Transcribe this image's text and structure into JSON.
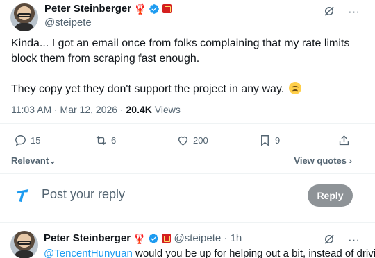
{
  "tweet": {
    "author_name": "Peter Steinberger",
    "author_emoji": "🦞",
    "handle": "@steipete",
    "body_line1": "Kinda... I got an email once from folks complaining that my rate limits block them from scraping fast enough.",
    "body_line2": "They copy yet they don't support the project in any way.",
    "time": "11:03 AM · Mar 12, 2026 · ",
    "views_count": "20.4K",
    "views_label": " Views",
    "more_label": "···"
  },
  "metrics": {
    "replies": "15",
    "reposts": "6",
    "likes": "200",
    "bookmarks": "9"
  },
  "controls": {
    "sort_label": "Relevant",
    "sort_chevron": "⌄",
    "view_quotes_label": "View quotes",
    "view_quotes_chevron": "›"
  },
  "composer": {
    "placeholder": "Post your reply",
    "reply_button": "Reply"
  },
  "reply": {
    "author_name": "Peter Steinberger",
    "author_emoji": "🦞",
    "handle_time": "@steipete · 1h",
    "mention": "@TencentHunyuan",
    "text": " would you be up for helping out a bit, instead of driving",
    "more_label": "···"
  },
  "colors": {
    "accent": "#1d9bf0",
    "text": "#0f1419",
    "muted": "#536471",
    "reply_button_bg": "#8e9397"
  },
  "icons": {
    "verified": "verified-badge-icon",
    "flag": "red-flag-icon",
    "grok": "grok-icon",
    "more": "more-icon",
    "reply": "reply-icon",
    "repost": "repost-icon",
    "like": "like-icon",
    "bookmark": "bookmark-icon",
    "share": "share-icon",
    "compose": "compose-icon"
  }
}
